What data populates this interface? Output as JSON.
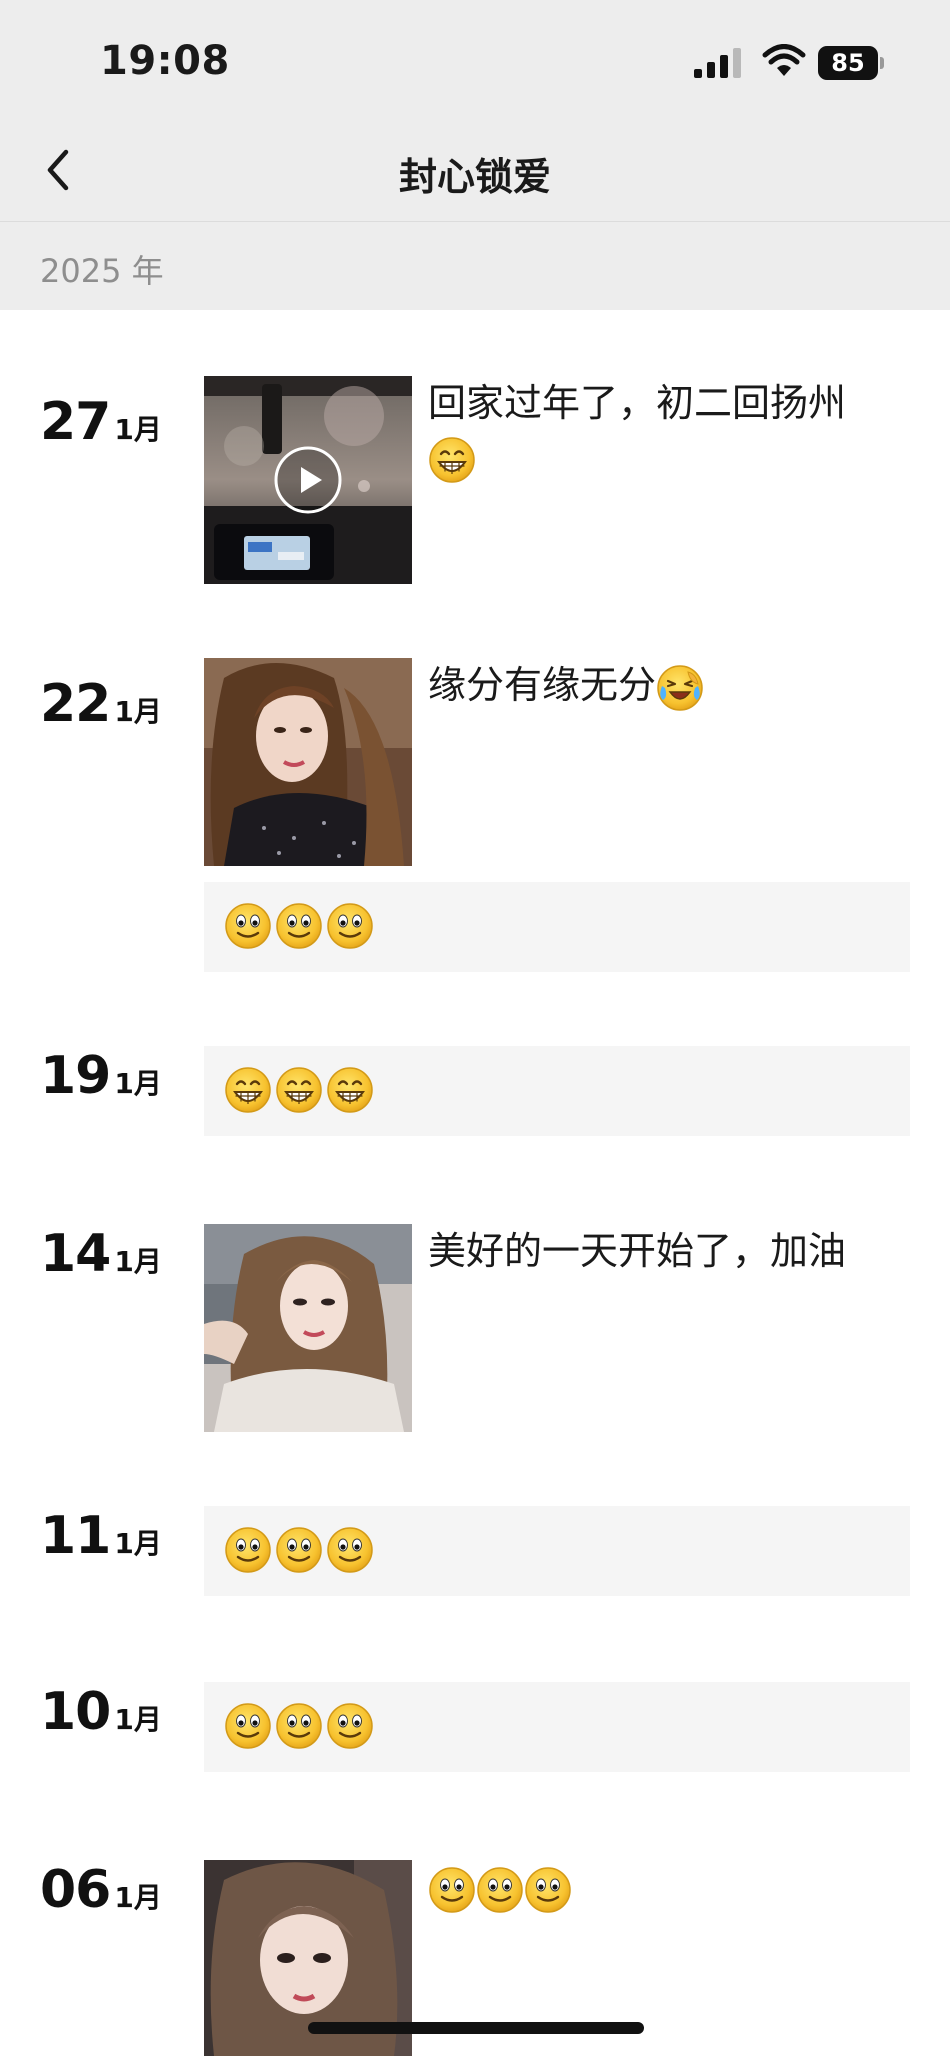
{
  "status_bar": {
    "time": "19:08",
    "battery": "85"
  },
  "header": {
    "title": "封心锁爱"
  },
  "year_section": {
    "label": "2025 年"
  },
  "posts": [
    {
      "day": "27",
      "month": "1月",
      "text": "回家过年了，初二回扬州",
      "emojis": [
        "grin"
      ],
      "media": "video"
    },
    {
      "day": "22",
      "month": "1月",
      "text": "缘分有缘无分",
      "emojis": [
        "cry-laugh"
      ],
      "media": "photo",
      "card_emojis": [
        "smile",
        "smile",
        "smile"
      ]
    },
    {
      "day": "19",
      "month": "1月",
      "card_emojis": [
        "grin",
        "grin",
        "grin"
      ]
    },
    {
      "day": "14",
      "month": "1月",
      "text": "美好的一天开始了，加油",
      "media": "photo"
    },
    {
      "day": "11",
      "month": "1月",
      "card_emojis": [
        "smile",
        "smile",
        "smile"
      ]
    },
    {
      "day": "10",
      "month": "1月",
      "card_emojis": [
        "smile",
        "smile",
        "smile"
      ]
    },
    {
      "day": "06",
      "month": "1月",
      "media": "photo",
      "emojis": [
        "smile",
        "smile",
        "smile"
      ]
    }
  ]
}
